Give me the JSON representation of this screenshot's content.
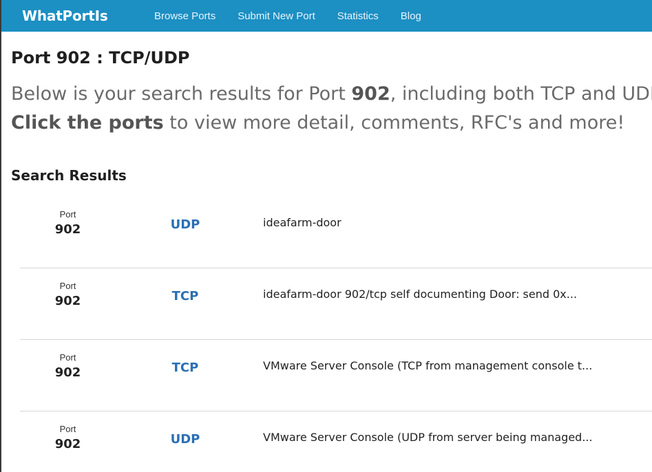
{
  "navbar": {
    "brand": "WhatPortIs",
    "links": [
      "Browse Ports",
      "Submit New Port",
      "Statistics",
      "Blog"
    ]
  },
  "page": {
    "title": "Port 902 : TCP/UDP",
    "lead_line1_a": "Below is your search results for Port ",
    "lead_line1_b": "902",
    "lead_line1_c": ", including both TCP and UDP",
    "lead_line2_a": "Click the ports",
    "lead_line2_b": " to view more detail, comments, RFC's and more!",
    "results_heading": "Search Results"
  },
  "results": [
    {
      "port_label": "Port",
      "port": "902",
      "protocol": "UDP",
      "description": "ideafarm-door"
    },
    {
      "port_label": "Port",
      "port": "902",
      "protocol": "TCP",
      "description": "ideafarm-door 902/tcp self documenting Door: send 0x..."
    },
    {
      "port_label": "Port",
      "port": "902",
      "protocol": "TCP",
      "description": "VMware Server Console (TCP from management console t..."
    },
    {
      "port_label": "Port",
      "port": "902",
      "protocol": "UDP",
      "description": "VMware Server Console (UDP from server being managed..."
    }
  ],
  "colors": {
    "navbar_bg": "#1c8fc3",
    "protocol_link": "#2a6fb4"
  }
}
